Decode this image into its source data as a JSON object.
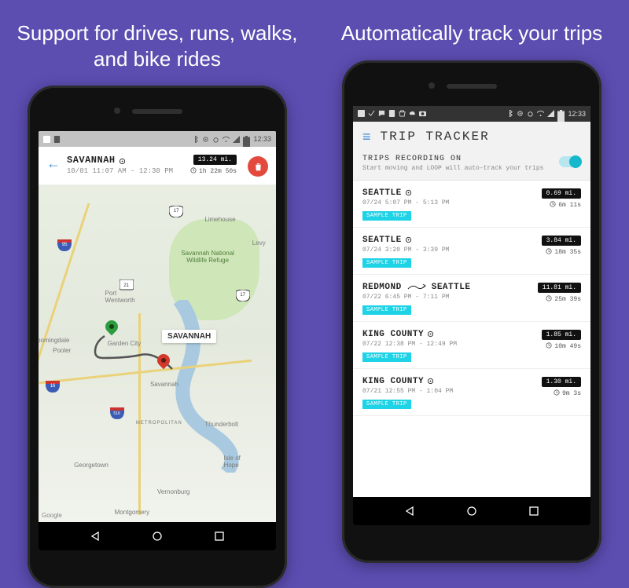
{
  "left": {
    "headline": "Support for drives, runs, walks, and bike rides",
    "status_time": "12:33",
    "detail": {
      "city": "SAVANNAH",
      "time_range": "10/01 11:07 AM - 12:30 PM",
      "distance": "13.24 mi.",
      "duration": "1h 22m 50s"
    },
    "map": {
      "callout": "SAVANNAH",
      "park": "Savannah National Wildlife Refuge",
      "attrib": "Google",
      "towns": {
        "limehouse": "Limehouse",
        "levy": "Levy",
        "port_wentworth": "Port Wentworth",
        "garden_city": "Garden City",
        "pooler": "Pooler",
        "bloomingdale": "Bloomingdale",
        "savannah": "Savannah",
        "georgetown": "Georgetown",
        "thunderbolt": "Thunderbolt",
        "isle_of_hope": "Isle of Hope",
        "vernonburg": "Vernonburg",
        "montgomery": "Montgomery",
        "metropolitan": "METROPOLITAN"
      },
      "highways": {
        "i95": "95",
        "us17a": "17",
        "us17b": "17",
        "i16": "16",
        "i516": "516",
        "sr21": "21"
      }
    }
  },
  "right": {
    "headline": "Automatically track your trips",
    "status_time": "12:33",
    "app_title": "TRIP TRACKER",
    "recording": {
      "title": "TRIPS RECORDING ON",
      "sub": "Start moving and LOOP will auto-track your trips"
    },
    "sample_label": "SAMPLE TRIP",
    "trips": [
      {
        "title": "SEATTLE",
        "route_to": "",
        "time": "07/24 5:07 PM - 5:13 PM",
        "distance": "0.69 mi.",
        "duration": "6m 11s"
      },
      {
        "title": "SEATTLE",
        "route_to": "",
        "time": "07/24 3:20 PM - 3:39 PM",
        "distance": "3.84 mi.",
        "duration": "18m 35s"
      },
      {
        "title": "REDMOND",
        "route_to": "SEATTLE",
        "time": "07/22 6:45 PM - 7:11 PM",
        "distance": "11.81 mi.",
        "duration": "25m 39s"
      },
      {
        "title": "KING COUNTY",
        "route_to": "",
        "time": "07/22 12:38 PM - 12:49 PM",
        "distance": "1.85 mi.",
        "duration": "10m 49s"
      },
      {
        "title": "KING COUNTY",
        "route_to": "",
        "time": "07/21 12:55 PM - 1:04 PM",
        "distance": "1.30 mi.",
        "duration": "9m 3s"
      }
    ]
  }
}
